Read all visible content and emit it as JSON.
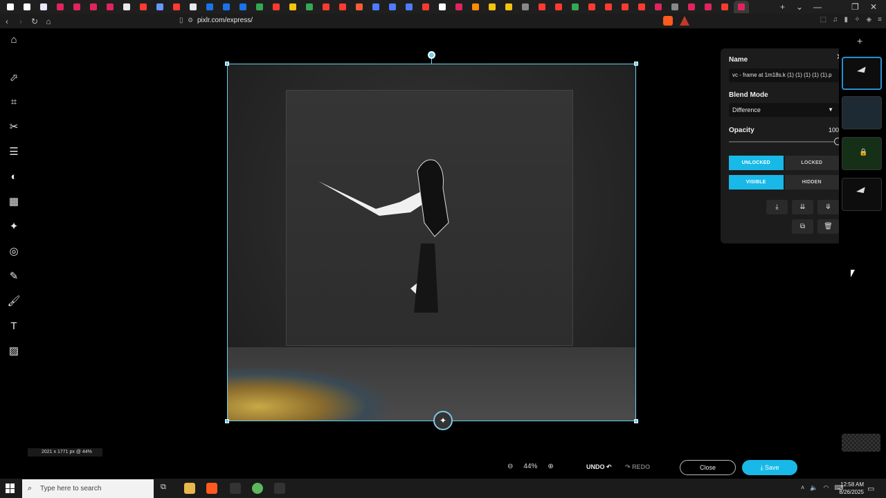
{
  "browser": {
    "url": "pixlr.com/express/",
    "tab_colors": [
      "#ffffff",
      "#ffffff",
      "#e8e8ff",
      "#e0245e",
      "#e0245e",
      "#e0245e",
      "#e0245e",
      "#e8e8e8",
      "#ff3b30",
      "#6699ff",
      "#ff3b30",
      "#e8e8e8",
      "#1a73e8",
      "#1a73e8",
      "#1a73e8",
      "#34a853",
      "#ff3b30",
      "#f1c40f",
      "#34a853",
      "#ff3b30",
      "#ff3b30",
      "#ff5a36",
      "#4d7cff",
      "#4d7cff",
      "#4d7cff",
      "#ff3b30",
      "#ffffff",
      "#e0245e",
      "#ff8c00",
      "#f1c40f",
      "#f1c40f",
      "#888888",
      "#ff3b30",
      "#ff3b30",
      "#34a853",
      "#ff3b30",
      "#ff3b30",
      "#ff3b30",
      "#ff3b30",
      "#e0245e",
      "#888888",
      "#e0245e",
      "#e0245e",
      "#ff3b30",
      "#e0245e"
    ],
    "window_controls": {
      "new_tab": "+",
      "dropdown": "⌄",
      "minimize": "—",
      "restore": "❐",
      "close": "✕"
    }
  },
  "editor": {
    "dimensions_label": "2021 x 1771 px @ 44%",
    "zoom_value": "44%",
    "undo_label": "UNDO",
    "redo_label": "REDO",
    "close_label": "Close",
    "save_label": "Save"
  },
  "layer_panel": {
    "name_label": "Name",
    "name_value": "vc - frame at 1m18s.k (1) (1) (1) (1) (1).p",
    "blend_mode_label": "Blend Mode",
    "blend_mode_value": "Difference",
    "opacity_label": "Opacity",
    "opacity_value": "100",
    "opacity_fraction": 1.0,
    "unlocked_label": "UNLOCKED",
    "locked_label": "LOCKED",
    "visible_label": "VISIBLE",
    "hidden_label": "HIDDEN",
    "lock_state": "unlocked",
    "visibility_state": "visible"
  },
  "taskbar": {
    "search_placeholder": "Type here to search",
    "time": "12:58 AM",
    "date": "8/26/2025"
  },
  "colors": {
    "accent": "#18b9e8",
    "selection": "#6ad3f0"
  }
}
